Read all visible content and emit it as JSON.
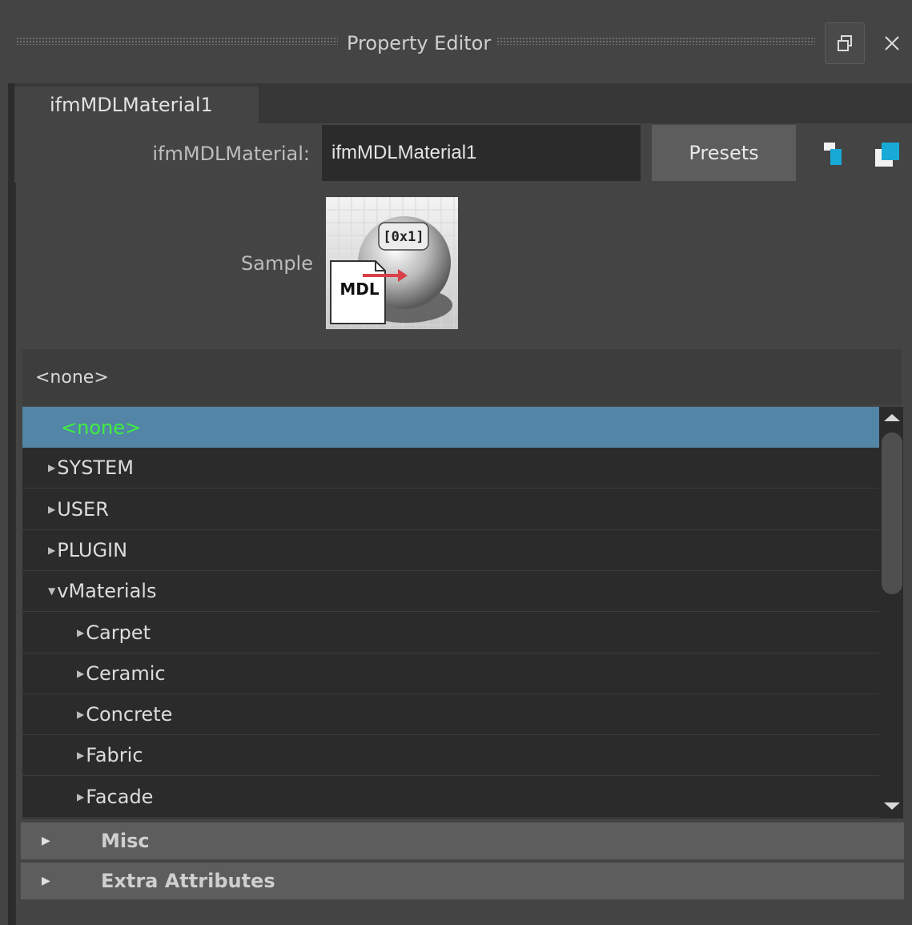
{
  "window": {
    "title": "Property Editor",
    "restore_label": "restore-icon",
    "close_label": "close-icon"
  },
  "tab": {
    "label": "ifmMDLMaterial1"
  },
  "node": {
    "type_label": "ifmMDLMaterial:",
    "name_value": "ifmMDLMaterial1",
    "presets_label": "Presets",
    "accent_color": "#19a9d6"
  },
  "sample": {
    "label": "Sample",
    "badge_text": "[0x1]",
    "mdl_text": "MDL"
  },
  "material_dropdown": {
    "value": "<none>"
  },
  "material_list": {
    "items": [
      {
        "label": "<none>",
        "selected": true,
        "indent": 1,
        "expander": "none"
      },
      {
        "label": "SYSTEM",
        "selected": false,
        "indent": 0,
        "expander": "collapsed"
      },
      {
        "label": "USER",
        "selected": false,
        "indent": 0,
        "expander": "collapsed"
      },
      {
        "label": "PLUGIN",
        "selected": false,
        "indent": 0,
        "expander": "collapsed"
      },
      {
        "label": "vMaterials",
        "selected": false,
        "indent": 0,
        "expander": "expanded"
      },
      {
        "label": "Carpet",
        "selected": false,
        "indent": 1,
        "expander": "collapsed"
      },
      {
        "label": "Ceramic",
        "selected": false,
        "indent": 1,
        "expander": "collapsed"
      },
      {
        "label": "Concrete",
        "selected": false,
        "indent": 1,
        "expander": "collapsed"
      },
      {
        "label": "Fabric",
        "selected": false,
        "indent": 1,
        "expander": "collapsed"
      },
      {
        "label": "Facade",
        "selected": false,
        "indent": 1,
        "expander": "collapsed"
      }
    ],
    "selected_color": "#5285a6",
    "selected_text_color": "#3fef3f"
  },
  "sections": [
    {
      "label": "Misc",
      "expanded": false
    },
    {
      "label": "Extra Attributes",
      "expanded": false
    }
  ]
}
